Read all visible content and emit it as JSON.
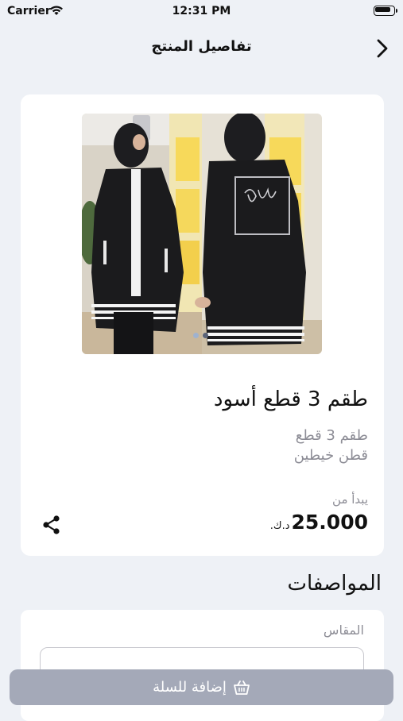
{
  "status_bar": {
    "carrier": "Carrier",
    "time": "12:31 PM"
  },
  "nav": {
    "title": "تفاصيل المنتج",
    "back_icon": "chevron-right-icon"
  },
  "product": {
    "name": "طقم 3 قطع أسود",
    "subtitle_1": "طقم 3 قطع",
    "subtitle_2": "قطن خيطين",
    "price_prefix": "يبدأ من",
    "price": "25.000",
    "currency": "د.ك.",
    "image_count": 2,
    "active_image": 1,
    "share_icon": "share-icon"
  },
  "specs": {
    "title": "المواصفات",
    "size_label": "المقاس",
    "size_placeholder": "المقاس"
  },
  "cart": {
    "button_label": "إضافة للسلة",
    "icon": "basket-icon"
  },
  "colors": {
    "background": "#eef1f6",
    "card": "#ffffff",
    "muted": "#8d8d96",
    "cart_button": "#a4a9b8",
    "product_black": "#1b1b1d"
  }
}
